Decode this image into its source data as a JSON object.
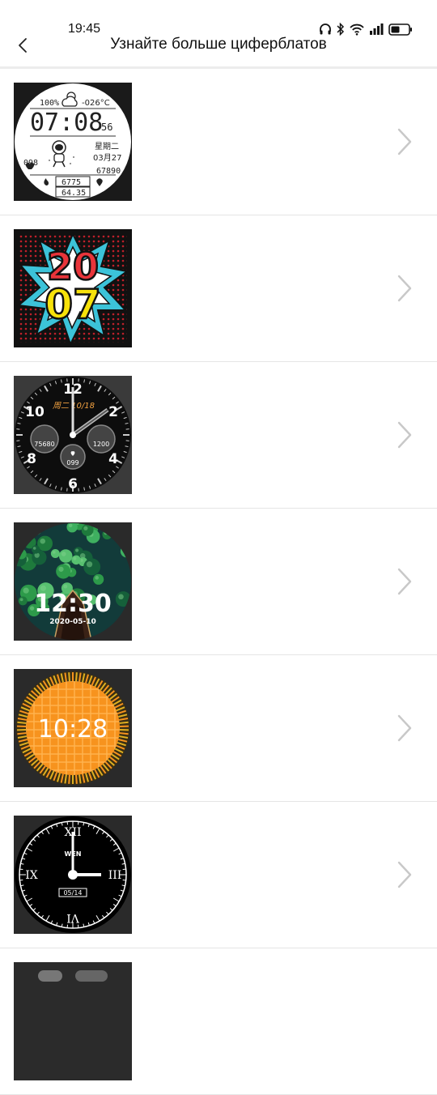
{
  "status_bar": {
    "time": "19:45",
    "icons": [
      "headphones-icon",
      "bluetooth-icon",
      "wifi-icon",
      "signal-icon",
      "battery-icon"
    ]
  },
  "header": {
    "title": "Узнайте больше циферблатов",
    "back_icon": "chevron-left-icon"
  },
  "watch_faces": [
    {
      "style": "digital-astronaut",
      "battery": "100%",
      "temperature": "-026°C",
      "time_hm": "07:08",
      "seconds": "56",
      "weekday": "星期二",
      "date": "03月27",
      "heart_rate": "098",
      "steps": "67890",
      "calories": "6775",
      "distance": "64.35"
    },
    {
      "style": "pop-art-year",
      "line1": "20",
      "line2": "07"
    },
    {
      "style": "analog-sport",
      "numerals": [
        "12",
        "2",
        "4",
        "6",
        "8",
        "10"
      ],
      "date": "周二 10/18",
      "left_value": "75680",
      "right_value": "1200",
      "bottom_value": "099"
    },
    {
      "style": "lotus-pond",
      "time": "12:30",
      "date": "2020-05-10"
    },
    {
      "style": "orange-sun",
      "time": "10:28"
    },
    {
      "style": "roman-classic",
      "numerals": [
        "XII",
        "III",
        "VI",
        "IX"
      ],
      "weekday": "WEN",
      "date": "05/14"
    },
    {
      "style": "partial-next"
    }
  ],
  "colors": {
    "chevron": "#c8c8c8",
    "divider": "#e5e5e5",
    "orange_face": "#f7931e",
    "pop_red": "#e8343a",
    "pop_yellow": "#f7e20a"
  }
}
